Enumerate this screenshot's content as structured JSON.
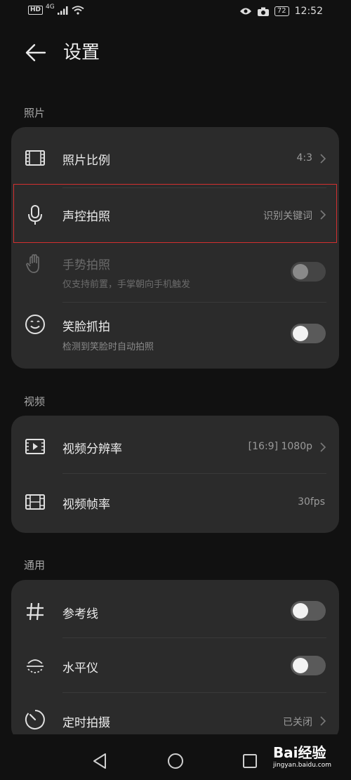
{
  "status_bar": {
    "network_left": "HD",
    "network_gen": "4G",
    "battery": "72",
    "time": "12:52"
  },
  "header": {
    "title": "设置"
  },
  "sections": {
    "photo": {
      "label": "照片",
      "aspect_ratio": {
        "title": "照片比例",
        "value": "4:3"
      },
      "voice_capture": {
        "title": "声控拍照",
        "value": "识别关键词"
      },
      "gesture_capture": {
        "title": "手势拍照",
        "subtitle": "仅支持前置，手掌朝向手机触发",
        "enabled": false,
        "disabled": true
      },
      "smile_capture": {
        "title": "笑脸抓拍",
        "subtitle": "检测到笑脸时自动拍照",
        "enabled": false
      }
    },
    "video": {
      "label": "视频",
      "resolution": {
        "title": "视频分辨率",
        "value": "[16:9] 1080p"
      },
      "frame_rate": {
        "title": "视频帧率",
        "value": "30fps"
      }
    },
    "general": {
      "label": "通用",
      "grid_lines": {
        "title": "参考线",
        "enabled": false
      },
      "level": {
        "title": "水平仪",
        "enabled": false
      },
      "timer": {
        "title": "定时拍摄",
        "value": "已关闭"
      }
    }
  },
  "watermark": {
    "brand": "Bai经验",
    "url": "jingyan.baidu.com"
  },
  "colors": {
    "background": "#111111",
    "card": "#2b2b2b",
    "highlight": "#d33030"
  }
}
